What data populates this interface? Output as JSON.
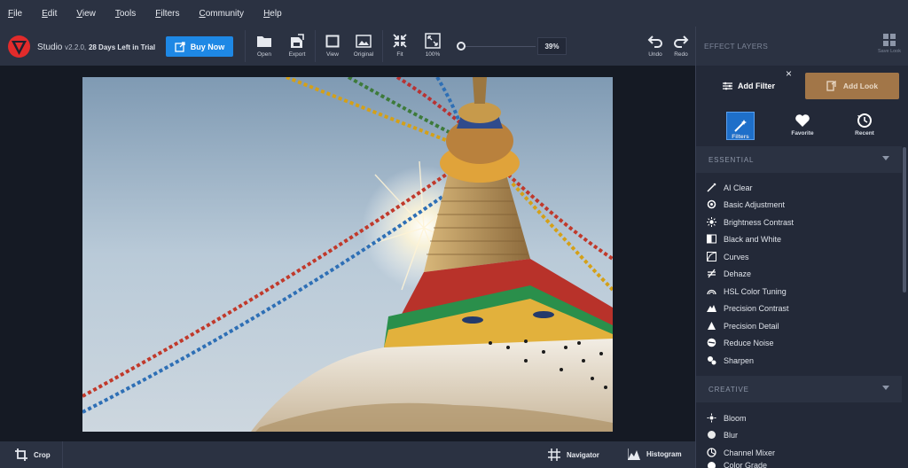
{
  "menu": [
    "File",
    "Edit",
    "View",
    "Tools",
    "Filters",
    "Community",
    "Help"
  ],
  "brand": {
    "name": "Studio",
    "version": "v2.2.0,",
    "trial": "28 Days Left in Trial"
  },
  "buy_label": "Buy Now",
  "toolbar": {
    "open": "Open",
    "export": "Export",
    "view": "View",
    "original": "Original",
    "fit": "Fit",
    "hundred": "100%",
    "zoom": "39%",
    "undo": "Undo",
    "redo": "Redo"
  },
  "bottom": {
    "crop": "Crop",
    "navigator": "Navigator",
    "histogram": "Histogram"
  },
  "panel": {
    "title": "EFFECT LAYERS",
    "save_look": "Save Look",
    "add_filter": "Add Filter",
    "close": "×",
    "add_look": "Add Look",
    "tabs": [
      "Filters",
      "Favorite",
      "Recent"
    ],
    "sections": {
      "essential": {
        "title": "ESSENTIAL",
        "items": [
          "AI Clear",
          "Basic Adjustment",
          "Brightness Contrast",
          "Black and White",
          "Curves",
          "Dehaze",
          "HSL Color Tuning",
          "Precision Contrast",
          "Precision Detail",
          "Reduce Noise",
          "Sharpen"
        ]
      },
      "creative": {
        "title": "CREATIVE",
        "items": [
          "Bloom",
          "Blur",
          "Channel Mixer",
          "Color Grade"
        ]
      }
    }
  },
  "colors": {
    "accent": "#1e88e5",
    "look": "#a27648",
    "bg": "#1c2230"
  }
}
